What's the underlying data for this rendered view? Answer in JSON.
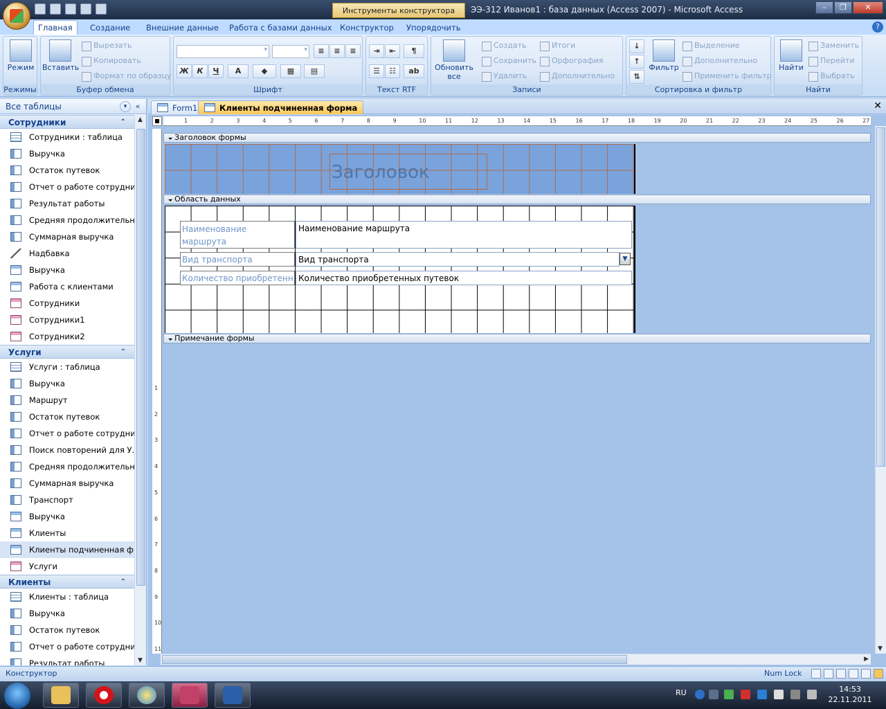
{
  "window": {
    "context_title": "Инструменты конструктора форм",
    "title": "ЭЭ-312 Иванов1 : база данных (Access 2007) - Microsoft Access",
    "min": "–",
    "max": "❐",
    "close": "✕"
  },
  "ribbon_tabs": [
    "Главная",
    "Создание",
    "Внешние данные",
    "Работа с базами данных",
    "Конструктор",
    "Упорядочить"
  ],
  "ribbon": {
    "modes": {
      "btn": "Режим",
      "label": "Режимы"
    },
    "clipboard": {
      "paste": "Вставить",
      "cut": "Вырезать",
      "copy": "Копировать",
      "format": "Формат по образцу",
      "label": "Буфер обмена"
    },
    "font": {
      "bold": "Ж",
      "italic": "К",
      "underline": "Ч",
      "fontcolor": "A",
      "label": "Шрифт"
    },
    "rtf": {
      "label": "Текст RTF"
    },
    "records": {
      "refresh": "Обновить все",
      "create": "Создать",
      "save": "Сохранить",
      "delete": "Удалить",
      "totals": "Итоги",
      "spelling": "Орфография",
      "more": "Дополнительно",
      "label": "Записи"
    },
    "sort": {
      "filter": "Фильтр",
      "selection": "Выделение",
      "advanced": "Дополнительно",
      "apply": "Применить фильтр",
      "label": "Сортировка и фильтр"
    },
    "find": {
      "find": "Найти",
      "replace": "Заменить",
      "goto": "Перейти",
      "select": "Выбрать",
      "label": "Найти"
    }
  },
  "nav": {
    "header": "Все таблицы",
    "groups": [
      {
        "name": "Сотрудники",
        "items": [
          {
            "icon": "table",
            "label": "Сотрудники : таблица"
          },
          {
            "icon": "query",
            "label": "Выручка"
          },
          {
            "icon": "query",
            "label": "Остаток путевок"
          },
          {
            "icon": "query",
            "label": "Отчет о работе сотрудни..."
          },
          {
            "icon": "query",
            "label": "Результат работы"
          },
          {
            "icon": "query",
            "label": "Средняя продолжительн..."
          },
          {
            "icon": "query",
            "label": "Суммарная выручка"
          },
          {
            "icon": "macro",
            "label": "Надбавка"
          },
          {
            "icon": "form",
            "label": "Выручка"
          },
          {
            "icon": "form",
            "label": "Работа с клиентами"
          },
          {
            "icon": "report",
            "label": "Сотрудники"
          },
          {
            "icon": "report",
            "label": "Сотрудники1"
          },
          {
            "icon": "report",
            "label": "Сотрудники2"
          }
        ]
      },
      {
        "name": "Услуги",
        "items": [
          {
            "icon": "table",
            "label": "Услуги : таблица"
          },
          {
            "icon": "query",
            "label": "Выручка"
          },
          {
            "icon": "query",
            "label": "Маршрут"
          },
          {
            "icon": "query",
            "label": "Остаток путевок"
          },
          {
            "icon": "query",
            "label": "Отчет о работе сотрудни..."
          },
          {
            "icon": "query",
            "label": "Поиск повторений для У..."
          },
          {
            "icon": "query",
            "label": "Средняя продолжительн..."
          },
          {
            "icon": "query",
            "label": "Суммарная выручка"
          },
          {
            "icon": "query",
            "label": "Транспорт"
          },
          {
            "icon": "form",
            "label": "Выручка"
          },
          {
            "icon": "form",
            "label": "Клиенты"
          },
          {
            "icon": "form",
            "label": "Клиенты подчиненная ф...",
            "selected": true
          },
          {
            "icon": "report",
            "label": "Услуги"
          }
        ]
      },
      {
        "name": "Клиенты",
        "items": [
          {
            "icon": "table",
            "label": "Клиенты : таблица"
          },
          {
            "icon": "query",
            "label": "Выручка"
          },
          {
            "icon": "query",
            "label": "Остаток путевок"
          },
          {
            "icon": "query",
            "label": "Отчет о работе сотрудни..."
          },
          {
            "icon": "query",
            "label": "Результат работы"
          }
        ]
      }
    ]
  },
  "doc_tabs": [
    {
      "label": "Form1",
      "active": false
    },
    {
      "label": "Клиенты подчиненная форма",
      "active": true
    }
  ],
  "designer": {
    "ruler_marks": [
      "1",
      "2",
      "3",
      "4",
      "5",
      "6",
      "7",
      "8",
      "9",
      "10",
      "11",
      "12",
      "13",
      "14",
      "15",
      "16",
      "17",
      "18",
      "19",
      "20",
      "21",
      "22",
      "23",
      "24",
      "25",
      "26",
      "27"
    ],
    "vruler_marks": [
      "1",
      "2",
      "3",
      "4",
      "5",
      "6",
      "7",
      "8",
      "9",
      "10",
      "11"
    ],
    "sections": {
      "header": "Заголовок формы",
      "detail": "Область данных",
      "footer": "Примечание формы"
    },
    "header_title": "Заголовок",
    "fields": [
      {
        "label": "Наименование маршрута",
        "value": "Наименование маршрута"
      },
      {
        "label": "Вид транспорта",
        "value": "Вид транспорта"
      },
      {
        "label": "Количество приобретенн",
        "value": "Количество приобретенных путевок"
      }
    ]
  },
  "status": {
    "mode": "Конструктор",
    "numlock": "Num Lock"
  },
  "taskbar": {
    "lang": "RU",
    "time": "14:53",
    "date": "22.11.2011"
  }
}
